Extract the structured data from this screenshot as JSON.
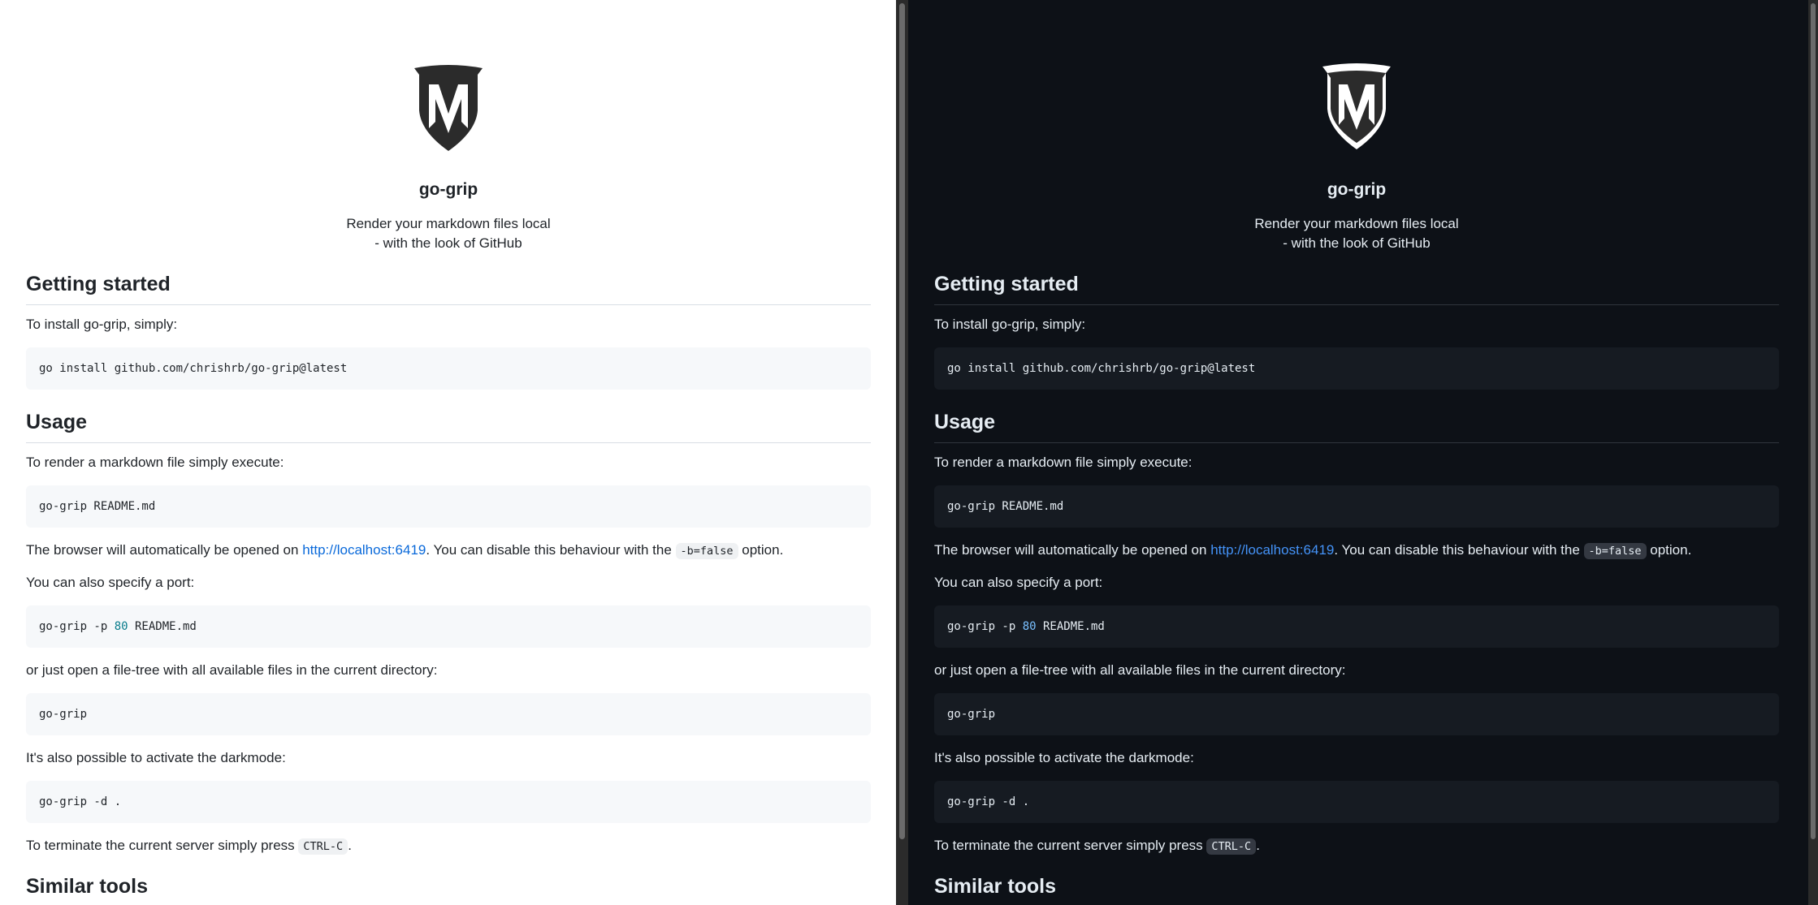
{
  "project": {
    "title": "go-grip",
    "tagline_line1": "Render your markdown files local",
    "tagline_line2": "- with the look of GitHub"
  },
  "sections": {
    "getting_started": {
      "heading": "Getting started",
      "intro": "To install go-grip, simply:",
      "install_cmd": "go install github.com/chrishrb/go-grip@latest"
    },
    "usage": {
      "heading": "Usage",
      "intro": "To render a markdown file simply execute:",
      "render_cmd": "go-grip README.md",
      "browser_text_before": "The browser will automatically be opened on ",
      "browser_link": "http://localhost:6419",
      "browser_text_middle": ". You can disable this behaviour with the ",
      "browser_flag": "-b=false",
      "browser_text_after": " option.",
      "port_intro": "You can also specify a port:",
      "port_cmd_prefix": "go-grip -p ",
      "port_cmd_number": "80",
      "port_cmd_suffix": " README.md",
      "tree_intro": "or just open a file-tree with all available files in the current directory:",
      "tree_cmd": "go-grip",
      "dark_intro": "It's also possible to activate the darkmode:",
      "dark_cmd": "go-grip -d .",
      "terminate_before": "To terminate the current server simply press ",
      "terminate_key": "CTRL-C",
      "terminate_after": "."
    },
    "similar": {
      "heading": "Similar tools"
    }
  },
  "colors": {
    "light_bg": "#ffffff",
    "dark_bg": "#0d1117",
    "light_link": "#0969da",
    "dark_link": "#4493f8"
  }
}
